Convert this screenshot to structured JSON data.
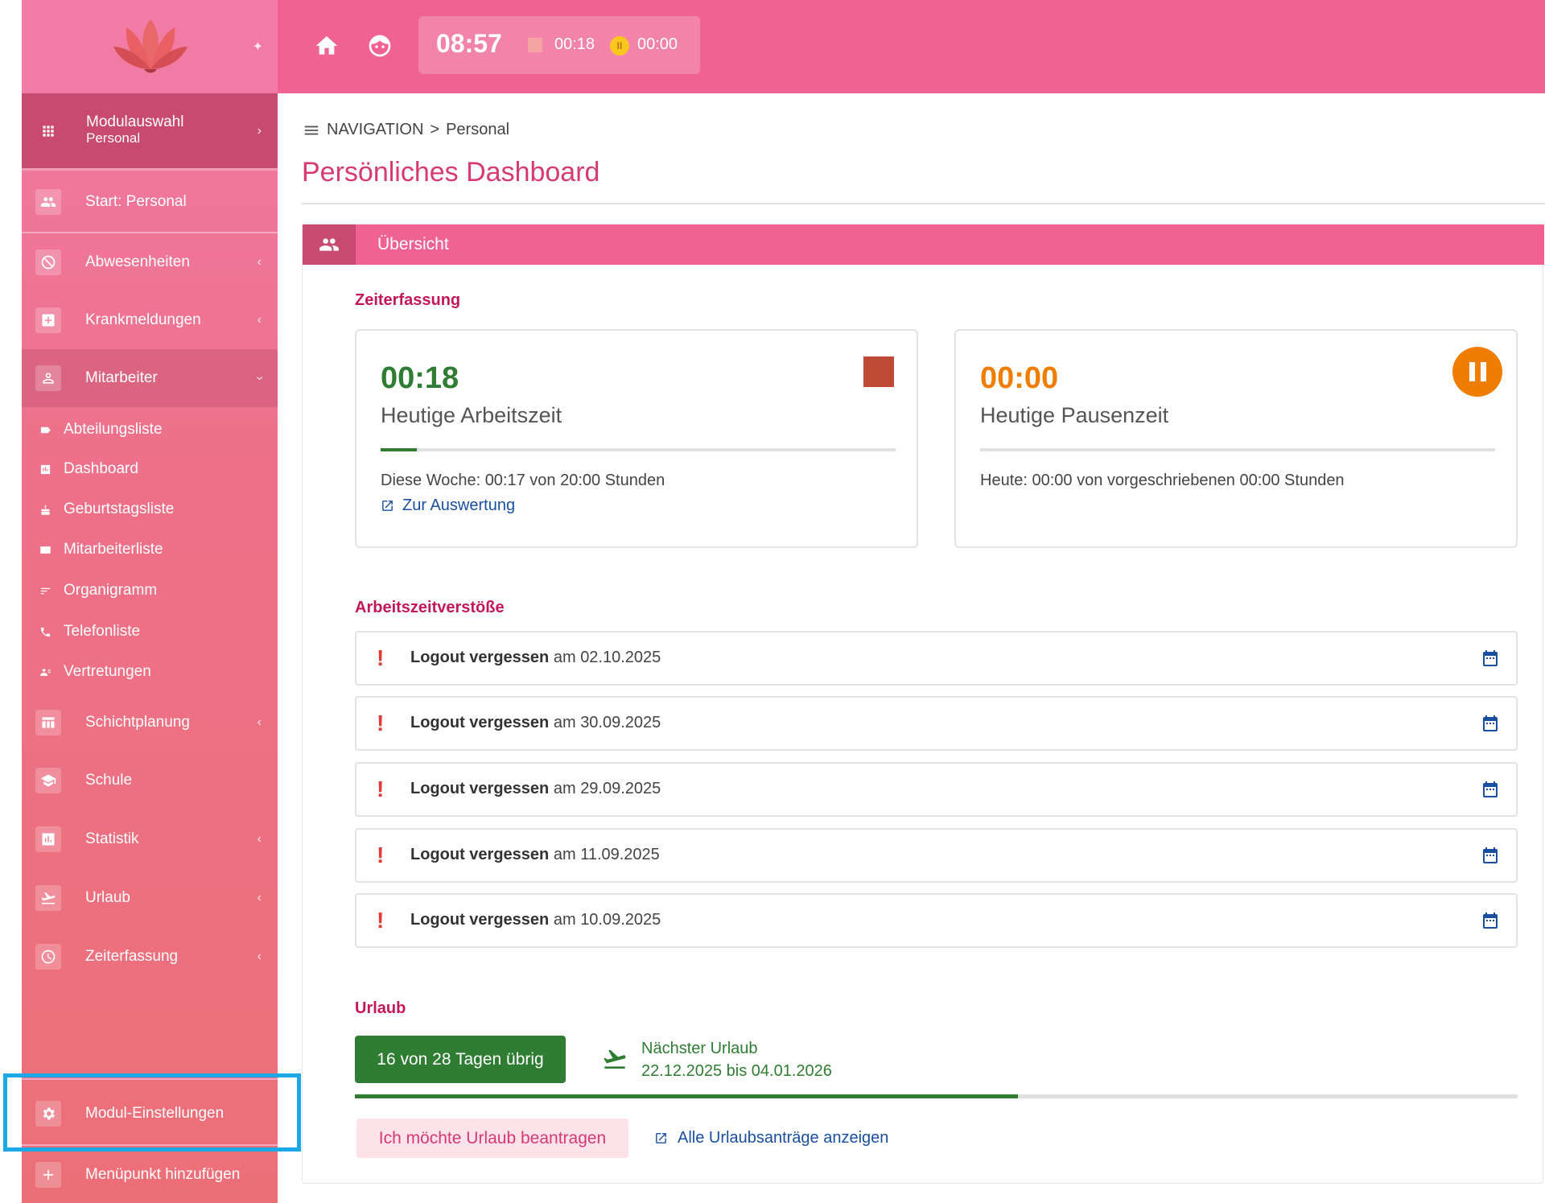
{
  "sidebar": {
    "module": {
      "title": "Modulauswahl",
      "subtitle": "Personal"
    },
    "items": [
      {
        "label": "Start: Personal"
      },
      {
        "label": "Abwesenheiten"
      },
      {
        "label": "Krankmeldungen"
      },
      {
        "label": "Mitarbeiter"
      },
      {
        "label": "Schichtplanung"
      },
      {
        "label": "Schule"
      },
      {
        "label": "Statistik"
      },
      {
        "label": "Urlaub"
      },
      {
        "label": "Zeiterfassung"
      }
    ],
    "subitems": [
      {
        "label": "Abteilungsliste"
      },
      {
        "label": "Dashboard"
      },
      {
        "label": "Geburtstagsliste"
      },
      {
        "label": "Mitarbeiterliste"
      },
      {
        "label": "Organigramm"
      },
      {
        "label": "Telefonliste"
      },
      {
        "label": "Vertretungen"
      }
    ],
    "footer": [
      {
        "label": "Modul-Einstellungen"
      },
      {
        "label": "Menüpunkt hinzufügen"
      }
    ]
  },
  "topbar": {
    "time": "08:57",
    "work": "00:18",
    "pause": "00:00",
    "pause_glyph": "II"
  },
  "breadcrumb": {
    "root": "NAVIGATION",
    "sep": ">",
    "current": "Personal"
  },
  "page_title": "Persönliches Dashboard",
  "panel_title": "Übersicht",
  "zeiterfassung": {
    "heading": "Zeiterfassung",
    "work": {
      "value": "00:18",
      "label": "Heutige Arbeitszeit",
      "info": "Diese Woche: 00:17 von 20:00 Stunden",
      "link": "Zur Auswertung",
      "progress": 0.07
    },
    "pause": {
      "value": "00:00",
      "label": "Heutige Pausenzeit",
      "info": "Heute: 00:00 von vorgeschriebenen 00:00 Stunden",
      "progress": 0
    }
  },
  "violations": {
    "heading": "Arbeitszeitverstöße",
    "items": [
      {
        "type": "Logout vergessen",
        "word": "am",
        "date": "02.10.2025"
      },
      {
        "type": "Logout vergessen",
        "word": "am",
        "date": "30.09.2025"
      },
      {
        "type": "Logout vergessen",
        "word": "am",
        "date": "29.09.2025"
      },
      {
        "type": "Logout vergessen",
        "word": "am",
        "date": "11.09.2025"
      },
      {
        "type": "Logout vergessen",
        "word": "am",
        "date": "10.09.2025"
      }
    ]
  },
  "urlaub": {
    "heading": "Urlaub",
    "remaining": "16 von 28 Tagen übrig",
    "next_label": "Nächster Urlaub",
    "next_range": "22.12.2025 bis 04.01.2026",
    "progress": 0.57,
    "request_button": "Ich möchte Urlaub beantragen",
    "all_link": "Alle Urlaubsanträge anzeigen"
  },
  "colors": {
    "primary": "#f06292",
    "accent": "#c2185b",
    "green": "#2e7d32",
    "orange": "#ef7d00",
    "link": "#1a4fa0",
    "highlight": "#1aa8e6"
  }
}
